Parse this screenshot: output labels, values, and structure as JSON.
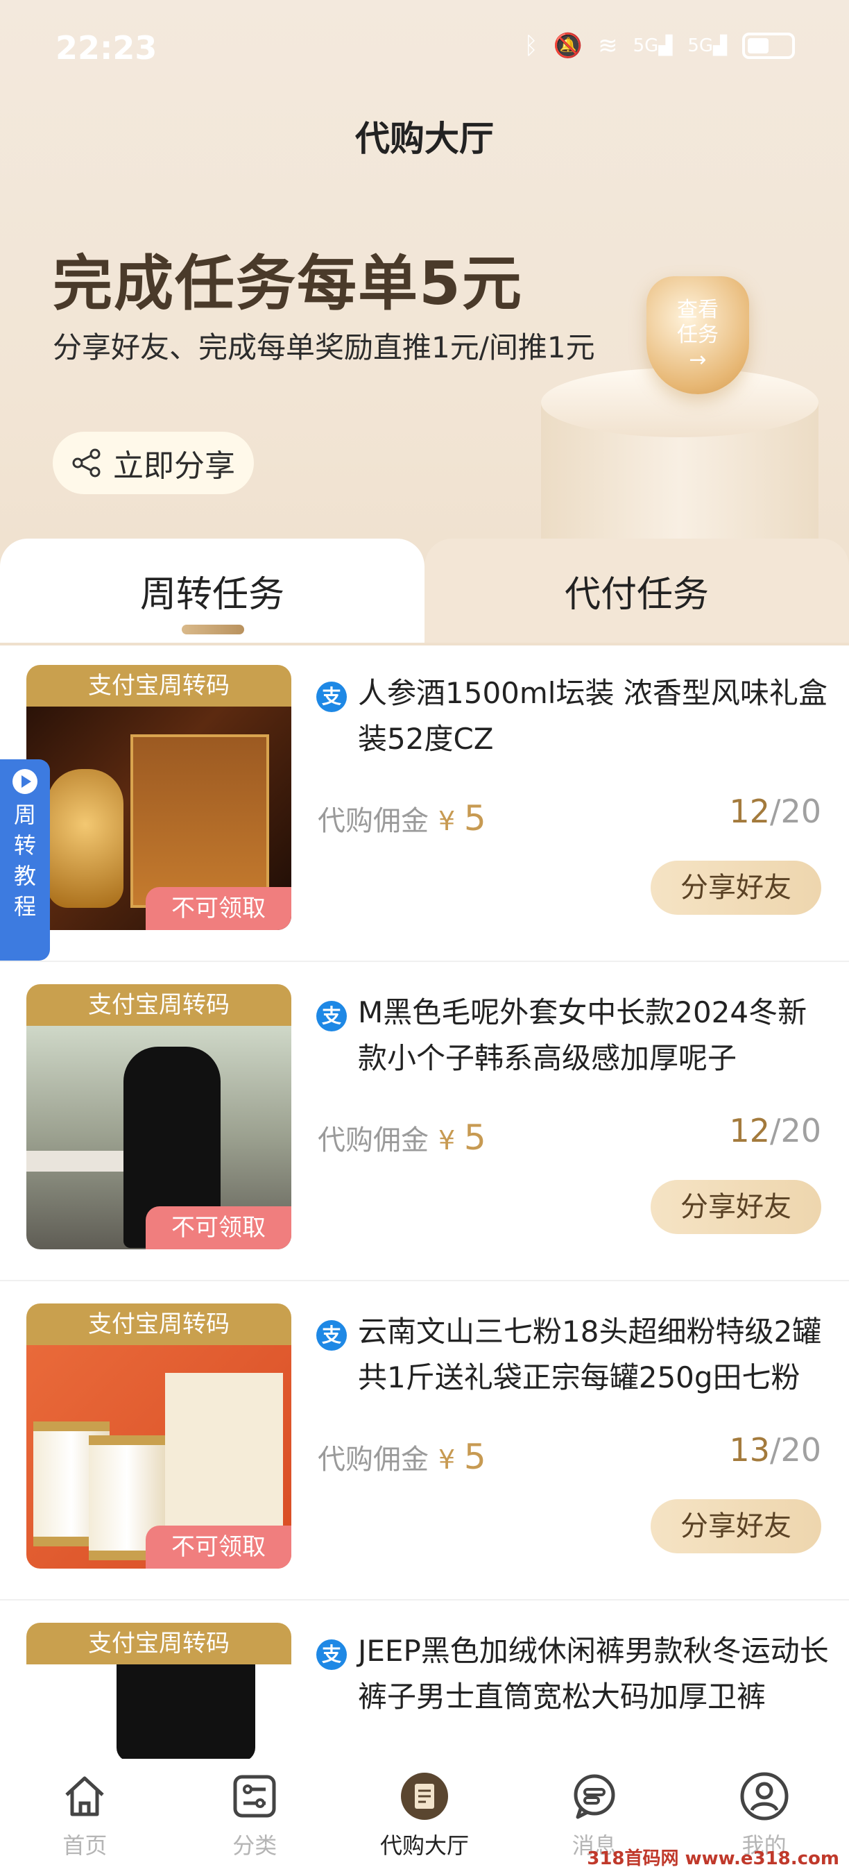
{
  "status_bar": {
    "time": "22:23",
    "icons": [
      "bluetooth-icon",
      "mute-icon",
      "wifi-icon",
      "5g-signal-icon",
      "5g-signal-icon",
      "battery-icon"
    ]
  },
  "page": {
    "title": "代购大厅"
  },
  "promo": {
    "title": "完成任务每单5元",
    "subtitle": "分享好友、完成每单奖励直推1元/间推1元",
    "share_button": "立即分享",
    "badge_line1": "查看",
    "badge_line2": "任务",
    "badge_arrow": "→"
  },
  "tabs": [
    {
      "label": "周转任务",
      "active": true
    },
    {
      "label": "代付任务",
      "active": false
    }
  ],
  "side_tab": {
    "chars": [
      "周",
      "转",
      "教",
      "程"
    ]
  },
  "items": [
    {
      "banner": "支付宝周转码",
      "tag": "不可领取",
      "title": "人参酒1500ml坛装 浓香型风味礼盒装52度CZ",
      "commission_label": "代购佣金",
      "currency": "¥",
      "amount": "5",
      "progress_done": "12",
      "progress_total": "/20",
      "action": "分享好友"
    },
    {
      "banner": "支付宝周转码",
      "tag": "不可领取",
      "title": "M黑色毛呢外套女中长款2024冬新款小个子韩系高级感加厚呢子",
      "commission_label": "代购佣金",
      "currency": "¥",
      "amount": "5",
      "progress_done": "12",
      "progress_total": "/20",
      "action": "分享好友"
    },
    {
      "banner": "支付宝周转码",
      "tag": "不可领取",
      "title": "云南文山三七粉18头超细粉特级2罐共1斤送礼袋正宗每罐250g田七粉",
      "commission_label": "代购佣金",
      "currency": "¥",
      "amount": "5",
      "progress_done": "13",
      "progress_total": "/20",
      "action": "分享好友"
    },
    {
      "banner": "支付宝周转码",
      "title": "JEEP黑色加绒休闲裤男款秋冬运动长裤子男士直筒宽松大码加厚卫裤"
    }
  ],
  "bottom_nav": [
    {
      "label": "首页",
      "icon": "home-icon"
    },
    {
      "label": "分类",
      "icon": "category-icon"
    },
    {
      "label": "代购大厅",
      "icon": "purchase-hall-icon",
      "active": true
    },
    {
      "label": "消息",
      "icon": "message-icon"
    },
    {
      "label": "我的",
      "icon": "profile-icon"
    }
  ],
  "watermark": "318首码网 www.e318.com",
  "colors": {
    "header_bg": "#f2e5d5",
    "accent_gold": "#c79a52",
    "banner_gold": "#c9a04e",
    "tag_red": "#f07e7e",
    "side_blue": "#3d7be0",
    "alipay_blue": "#1e88e5"
  }
}
